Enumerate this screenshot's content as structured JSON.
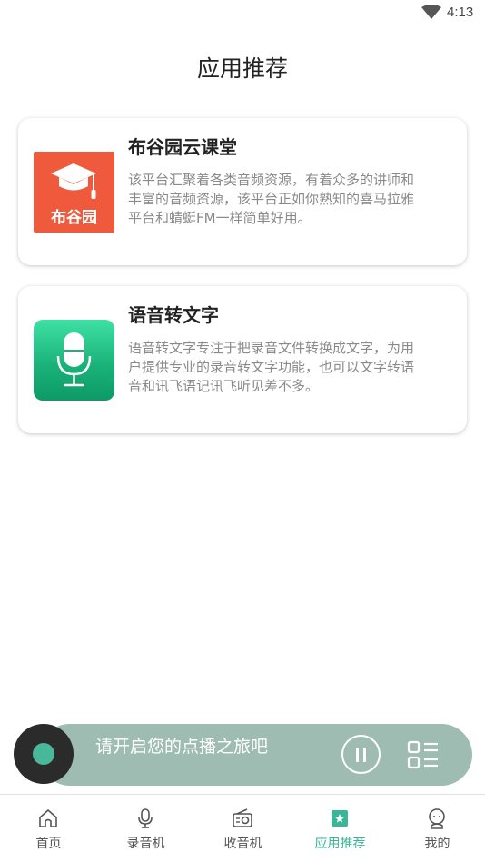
{
  "status_bar": {
    "time": "4:13",
    "wifi_icon": "wifi-icon"
  },
  "page": {
    "title": "应用推荐"
  },
  "apps": [
    {
      "name": "布谷园云课堂",
      "icon": "graduation-cap-icon",
      "icon_caption": "布谷园",
      "icon_color": "#f05a3c",
      "description": "该平台汇聚着各类音频资源，有着众多的讲师和丰富的音频资源，该平台正如你熟知的喜马拉雅平台和蜻蜓FM一样简单好用。"
    },
    {
      "name": "语音转文字",
      "icon": "microphone-icon",
      "icon_color": "#1bb37a",
      "description": "语音转文字专注于把录音文件转换成文字，为用户提供专业的录音转文字功能，也可以文字转语音和讯飞语记讯飞听见差不多。"
    }
  ],
  "player": {
    "text": "请开启您的点播之旅吧",
    "pill_color": "#9fbcb2",
    "disc_color": "#2b2b2b",
    "disc_center_color": "#49b89a"
  },
  "tabs": [
    {
      "label": "首页",
      "icon": "home-icon",
      "active": false
    },
    {
      "label": "录音机",
      "icon": "microphone-icon",
      "active": false
    },
    {
      "label": "收音机",
      "icon": "radio-icon",
      "active": false
    },
    {
      "label": "应用推荐",
      "icon": "app-recommend-icon",
      "active": true
    },
    {
      "label": "我的",
      "icon": "profile-icon",
      "active": false
    }
  ],
  "colors": {
    "accent": "#3bb597",
    "tab_inactive": "#555555",
    "description_text": "#8a8a8a"
  }
}
